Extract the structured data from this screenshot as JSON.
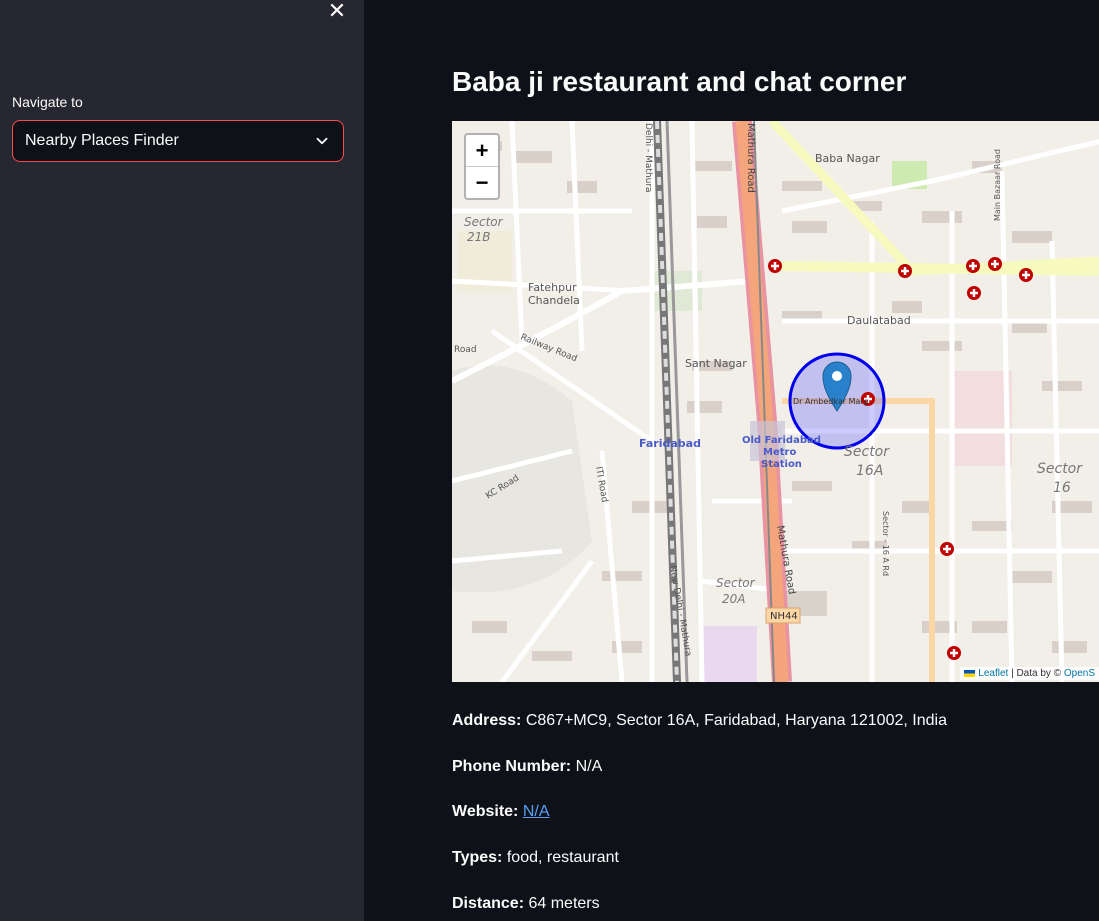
{
  "sidebar": {
    "close_icon": "close-icon",
    "nav_label": "Navigate to",
    "selected": "Nearby Places Finder",
    "accent": "#ff4b4b"
  },
  "main": {
    "title": "Baba ji restaurant and chat corner"
  },
  "map": {
    "zoom_in": "+",
    "zoom_out": "−",
    "attribution_link": "Leaflet",
    "attribution_text": "| Data by ©",
    "attribution_osm": "OpenS",
    "marker_icon": "map-pin-icon",
    "labels": {
      "baba_nagar": "Baba Nagar",
      "sector_21b_a": "Sector",
      "sector_21b_b": "21B",
      "fatehpur_a": "Fatehpur",
      "fatehpur_b": "Chandela",
      "daulatabad": "Daulatabad",
      "railway_road": "Railway Road",
      "sant_nagar": "Sant Nagar",
      "road": "Road",
      "faridabad": "Faridabad",
      "old_faridabad_a": "Old Faridabad",
      "old_faridabad_b": "Metro",
      "old_faridabad_c": "Station",
      "sector_16a_a": "Sector",
      "sector_16a_b": "16A",
      "sector_16_a": "Sector",
      "sector_16_b": "16",
      "kc_road": "KC Road",
      "iti_road": "ITI Road",
      "sector_20a_a": "Sector",
      "sector_20a_b": "20A",
      "mathura_road": "Mathura Road",
      "nh44": "NH44",
      "new_delhi_mathura": "New Delhi - Mathura",
      "delhi_mathura": "Delhi - Mathura",
      "sector_16a_rd": "Sector - 16 A Rd",
      "main_bazaar_road": "Main Bazaar Road",
      "ambedkar_marg": "Dr Ambedkar Marg"
    }
  },
  "details": {
    "address_label": "Address:",
    "address_value": "C867+MC9, Sector 16A, Faridabad, Haryana 121002, India",
    "phone_label": "Phone Number:",
    "phone_value": "N/A",
    "website_label": "Website:",
    "website_value": "N/A",
    "types_label": "Types:",
    "types_value": "food, restaurant",
    "distance_label": "Distance:",
    "distance_value": "64 meters"
  }
}
